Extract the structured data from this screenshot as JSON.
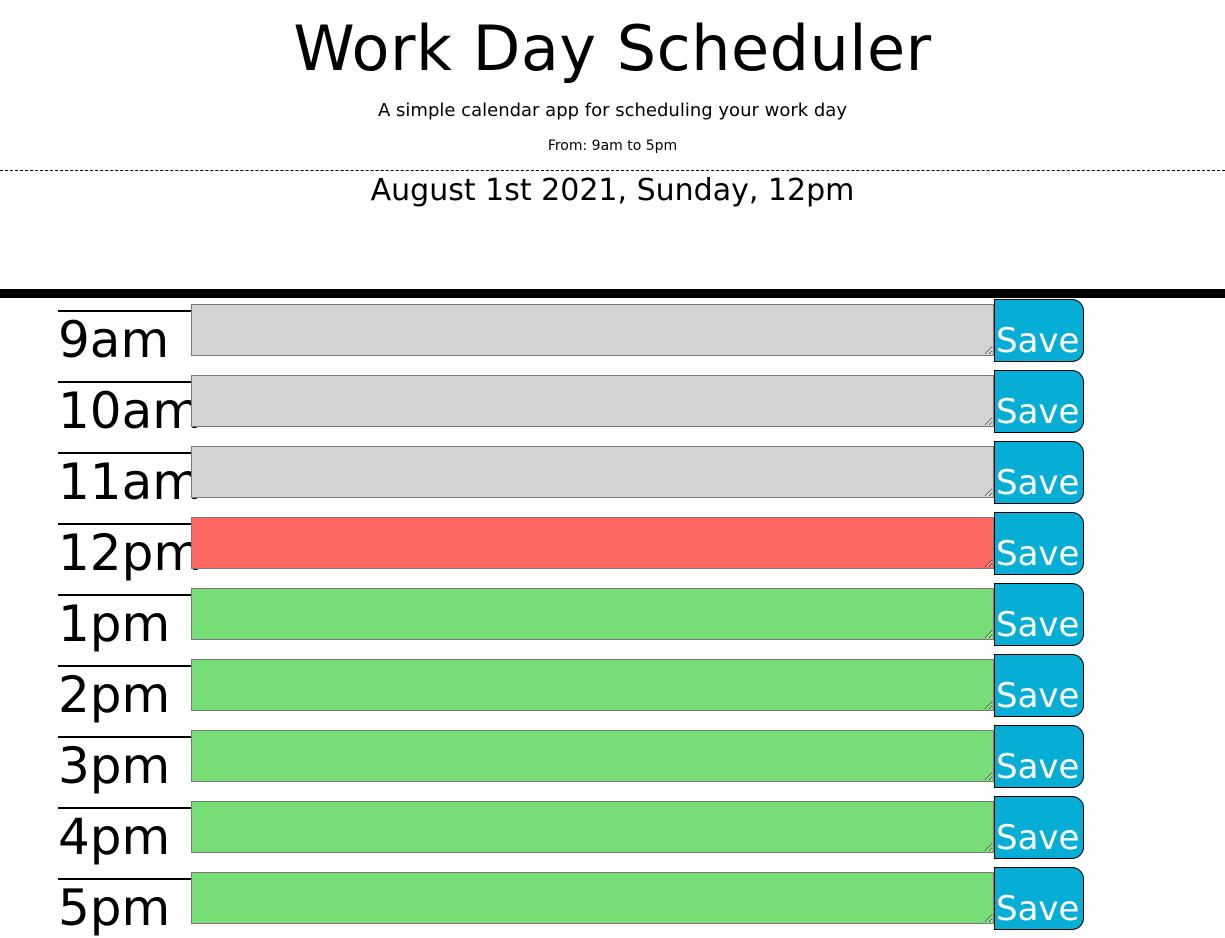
{
  "header": {
    "title": "Work Day Scheduler",
    "subtitle": "A simple calendar app for scheduling your work day",
    "hours": "From: 9am to 5pm"
  },
  "current_day": "August 1st 2021, Sunday, 12pm",
  "save_label": "Save",
  "colors": {
    "past": "#d3d3d3",
    "present": "#ff6961",
    "future": "#77dd77",
    "save_button": "#06aed5"
  },
  "timeblocks": [
    {
      "hour": "9am",
      "status": "past",
      "value": ""
    },
    {
      "hour": "10am",
      "status": "past",
      "value": ""
    },
    {
      "hour": "11am",
      "status": "past",
      "value": ""
    },
    {
      "hour": "12pm",
      "status": "present",
      "value": ""
    },
    {
      "hour": "1pm",
      "status": "future",
      "value": ""
    },
    {
      "hour": "2pm",
      "status": "future",
      "value": ""
    },
    {
      "hour": "3pm",
      "status": "future",
      "value": ""
    },
    {
      "hour": "4pm",
      "status": "future",
      "value": ""
    },
    {
      "hour": "5pm",
      "status": "future",
      "value": ""
    }
  ]
}
